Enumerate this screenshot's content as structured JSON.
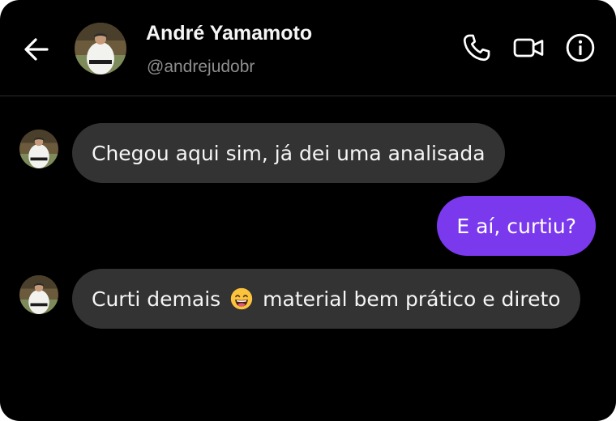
{
  "contact": {
    "name": "André Yamamoto",
    "handle": "@andrejudobr"
  },
  "header_icons": {
    "back": "arrow-left-icon",
    "call": "phone-icon",
    "video": "video-camera-icon",
    "info": "info-icon"
  },
  "messages": [
    {
      "direction": "incoming",
      "text": "Chegou aqui sim, já dei uma analisada"
    },
    {
      "direction": "outgoing",
      "text": "E aí, curtiu?"
    },
    {
      "direction": "incoming",
      "text_before": "Curti demais",
      "emoji": "😄",
      "text_after": "material bem prático e direto"
    }
  ],
  "colors": {
    "background": "#000000",
    "incoming_bubble": "#333333",
    "outgoing_bubble": "#7b39ed",
    "text_primary": "#f5f5f5",
    "text_secondary": "#8e8e8e"
  }
}
